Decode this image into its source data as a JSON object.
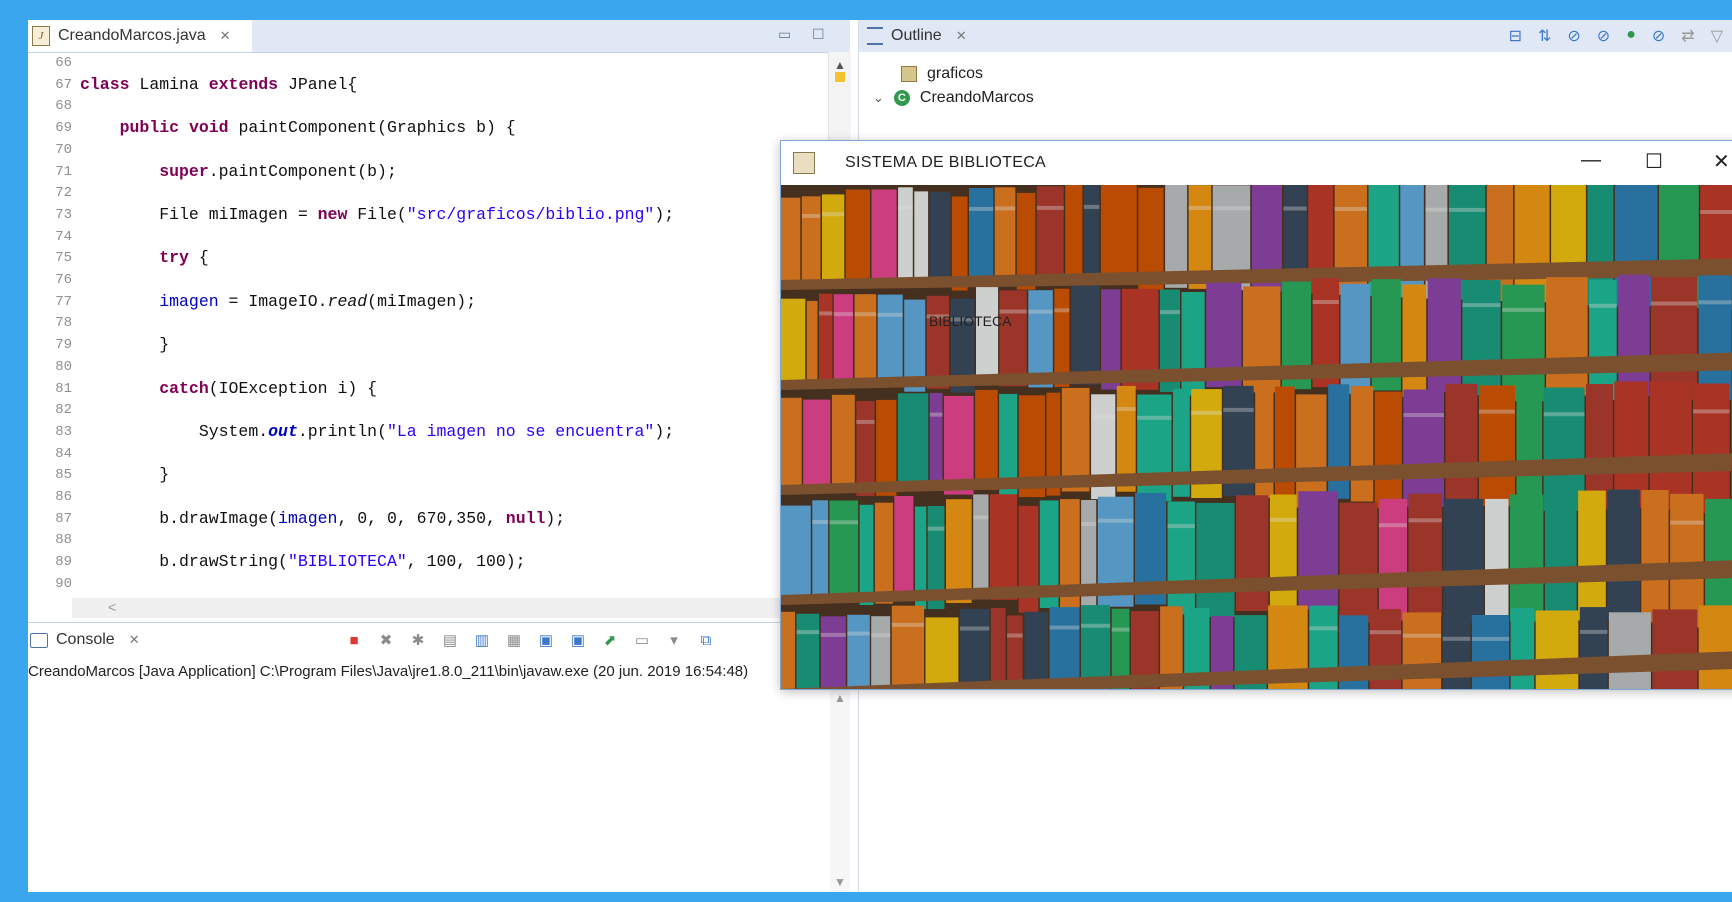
{
  "editor": {
    "tab_title": "CreandoMarcos.java",
    "lines": [
      {
        "num": "66",
        "text": ""
      },
      {
        "num": "67",
        "text": "class Lamina extends JPanel{"
      },
      {
        "num": "68",
        "text": ""
      },
      {
        "num": "69",
        "text": "    public void paintComponent(Graphics b) {"
      },
      {
        "num": "70",
        "text": ""
      },
      {
        "num": "71",
        "text": "        super.paintComponent(b);"
      },
      {
        "num": "72",
        "text": ""
      },
      {
        "num": "73",
        "text": "        File miImagen = new File(\"src/graficos/biblio.png\");"
      },
      {
        "num": "74",
        "text": ""
      },
      {
        "num": "75",
        "text": "        try {"
      },
      {
        "num": "76",
        "text": ""
      },
      {
        "num": "77",
        "text": "        imagen = ImageIO.read(miImagen);"
      },
      {
        "num": "78",
        "text": ""
      },
      {
        "num": "79",
        "text": "        }"
      },
      {
        "num": "80",
        "text": ""
      },
      {
        "num": "81",
        "text": "        catch(IOException i) {"
      },
      {
        "num": "82",
        "text": ""
      },
      {
        "num": "83",
        "text": "            System.out.println(\"La imagen no se encuentra\");"
      },
      {
        "num": "84",
        "text": ""
      },
      {
        "num": "85",
        "text": "        }"
      },
      {
        "num": "86",
        "text": ""
      },
      {
        "num": "87",
        "text": "        b.drawImage(imagen, 0, 0, 670,350, null);"
      },
      {
        "num": "88",
        "text": ""
      },
      {
        "num": "89",
        "text": "        b.drawString(\"BIBLIOTECA\", 100, 100);"
      },
      {
        "num": "90",
        "text": ""
      }
    ]
  },
  "console": {
    "tab_title": "Console",
    "description": "CreandoMarcos [Java Application] C:\\Program Files\\Java\\jre1.8.0_211\\bin\\javaw.exe (20 jun. 2019 16:54:48)"
  },
  "outline": {
    "tab_title": "Outline",
    "items": [
      {
        "label": "graficos"
      },
      {
        "label": "CreandoMarcos"
      }
    ]
  },
  "java_window": {
    "title": "SISTEMA DE BIBLIOTECA",
    "label": "BIBLIOTECA",
    "controls": {
      "minimize": "—",
      "maximize": "☐",
      "close": "✕"
    }
  },
  "colors": {
    "background": "#3aa6ee",
    "keyword": "#7f0055",
    "string": "#2a00ff",
    "field": "#0000c0",
    "tab_bar": "#dfe8f4"
  }
}
